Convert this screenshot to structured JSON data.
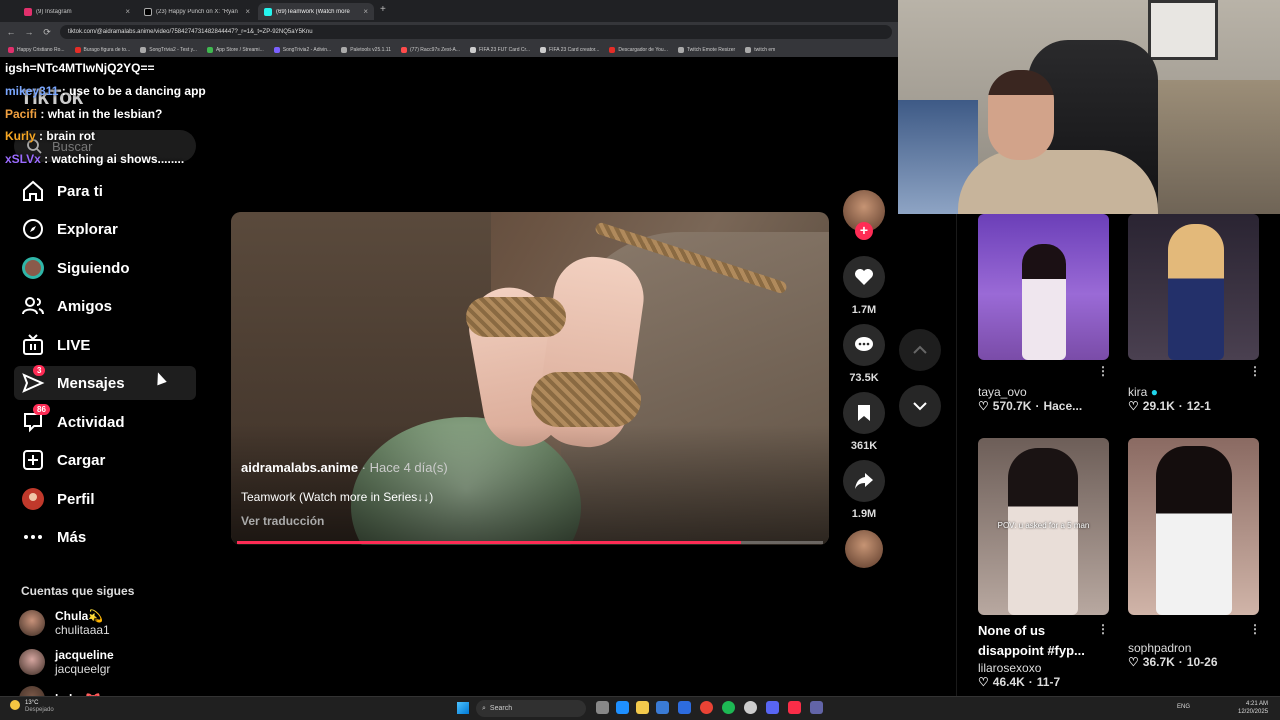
{
  "browser": {
    "tabs": [
      {
        "label": "(9) Instagram",
        "color": "#e1306c"
      },
      {
        "label": "(23) Happy Punch on X: \"Ryan",
        "color": "#ffffff"
      },
      {
        "label": "(69)Teamwork (Watch more",
        "color": "#25f4ee"
      }
    ],
    "url": "tiktok.com/@aidramalabs.anime/video/7584274731482844447?_r=1&_t=ZP-92NQ5aY5Knu",
    "bookmarks": [
      "Happy Cristiano Ro...",
      "Burago figura de to...",
      "SongTrivia2 - Test y...",
      "App Store / Streami...",
      "SongTrivia2 - Adivin...",
      "Paletools v25.1.11",
      "(77) Racc97s Zest-A...",
      "FIFA 23 FUT Card Cr...",
      "FIFA 23 Card creator...",
      "Descargador de You...",
      "Twitch Emote Resizer",
      "twitch em"
    ]
  },
  "chat": [
    {
      "user": "",
      "text": "igsh=NTc4MTIwNjQ2YQ==",
      "color": "#ffffff"
    },
    {
      "user": "mikey311",
      "text": "use to be a dancing app",
      "color": "#7aa7ff"
    },
    {
      "user": "Pacifi",
      "text": "what in the lesbian?",
      "color": "#f0a040"
    },
    {
      "user": "Kurly",
      "text": "brain rot",
      "color": "#f5a623"
    },
    {
      "user": "xSLVx",
      "text": "watching ai shows........",
      "color": "#9b6bff"
    }
  ],
  "sidebar": {
    "logo": "TikTok",
    "search_placeholder": "Buscar",
    "items": [
      {
        "label": "Para ti",
        "icon": "home-icon"
      },
      {
        "label": "Explorar",
        "icon": "compass-icon"
      },
      {
        "label": "Siguiendo",
        "icon": "avatar-icon"
      },
      {
        "label": "Amigos",
        "icon": "friends-icon"
      },
      {
        "label": "LIVE",
        "icon": "live-tv-icon"
      },
      {
        "label": "Mensajes",
        "icon": "send-icon",
        "badge": "3"
      },
      {
        "label": "Actividad",
        "icon": "activity-icon",
        "badge": "86"
      },
      {
        "label": "Cargar",
        "icon": "upload-icon"
      },
      {
        "label": "Perfil",
        "icon": "profile-icon"
      },
      {
        "label": "Más",
        "icon": "more-icon"
      }
    ],
    "followed_title": "Cuentas que sigues",
    "followed": [
      {
        "name": "Chula💫",
        "handle": "chulitaaa1"
      },
      {
        "name": "jacqueline",
        "handle": "jacqueelgr"
      },
      {
        "name": "haley🎀",
        "handle": ""
      }
    ]
  },
  "video": {
    "username": "aidramalabs.anime",
    "time": " · Hace 4 día(s)",
    "caption": "Teamwork (Watch more in Series↓↓)",
    "translate": "Ver traducción",
    "progress": 0.86
  },
  "actions": {
    "likes": "1.7M",
    "comments": "73.5K",
    "saves": "361K",
    "shares": "1.9M"
  },
  "explore": [
    {
      "user": "taya_ovo",
      "likes": "570.7K",
      "meta": "Hace...",
      "title": ""
    },
    {
      "user": "kira",
      "likes": "29.1K",
      "meta": "12-1",
      "title": "",
      "verified": true
    },
    {
      "user": "lilarosexoxo",
      "likes": "46.4K",
      "meta": "11-7",
      "title": "None of us disappoint #fyp...",
      "overlay": "POV: u asked for a 5 man"
    },
    {
      "user": "sophpadron",
      "likes": "36.7K",
      "meta": "10-26",
      "title": ""
    }
  ],
  "taskbar": {
    "weather_temp": "13°C",
    "weather_desc": "Despejado",
    "search": "Search",
    "lang": "ENG",
    "time": "4:21 AM",
    "date": "12/20/2025"
  }
}
